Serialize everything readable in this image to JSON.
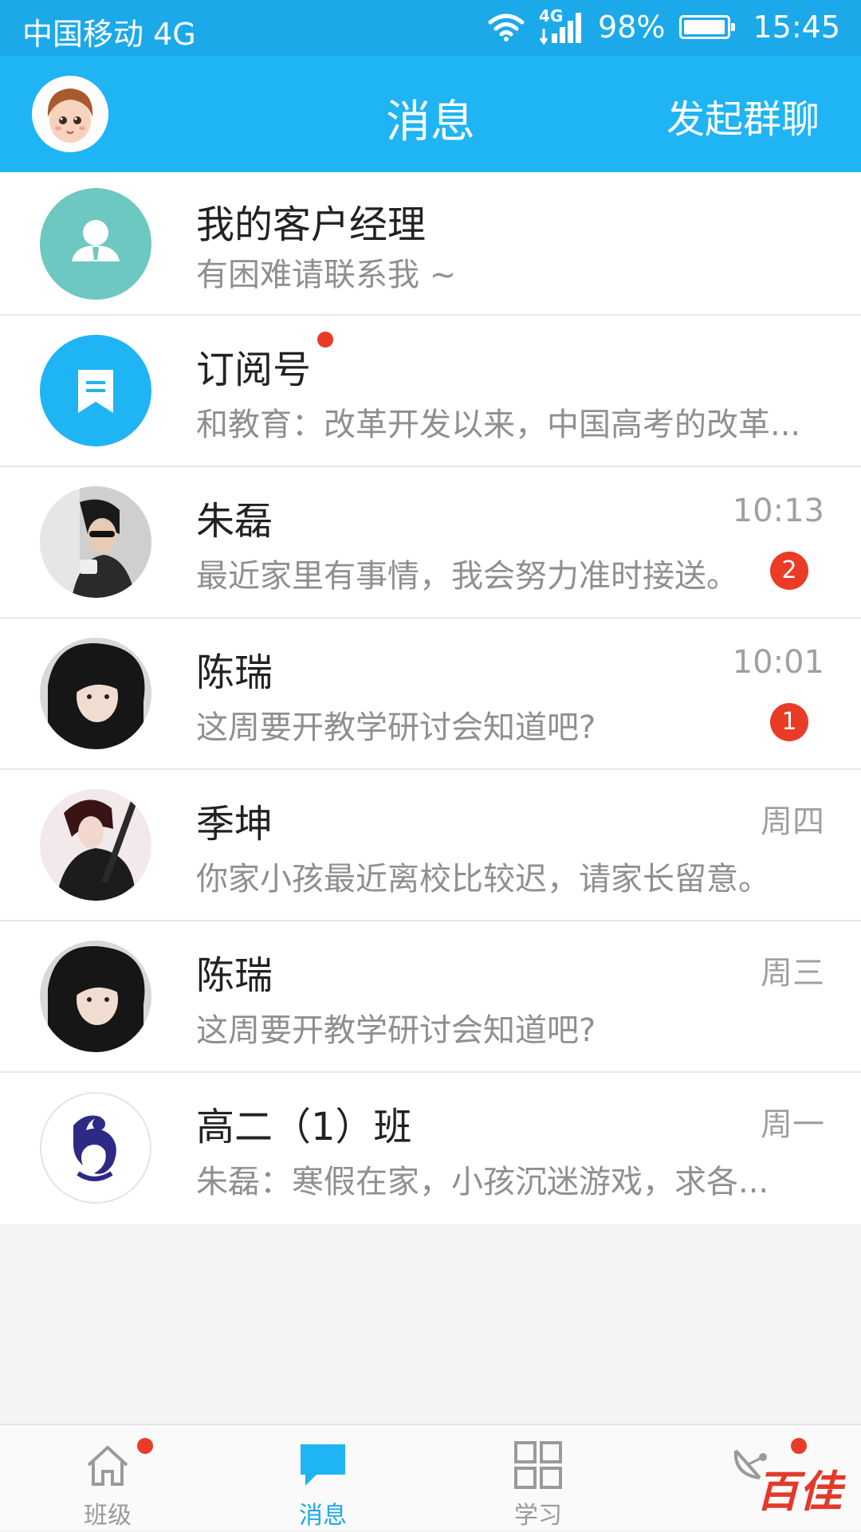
{
  "status_bar": {
    "carrier": "中国移动 4G",
    "network": "4G",
    "battery": "98%",
    "battery_level": 0.98,
    "time": "15:45",
    "icons": [
      "wifi-icon",
      "signal-icon",
      "battery-icon"
    ]
  },
  "header": {
    "title": "消息",
    "action_label": "发起群聊",
    "background": "#1fb4f4"
  },
  "conversations": [
    {
      "name": "我的客户经理",
      "preview": "有困难请联系我 ~",
      "time": "",
      "badge": "",
      "avatar": "manager-icon",
      "avatar_color": "#6cc8c1"
    },
    {
      "name": "订阅号",
      "preview": "和教育：改革开发以来，中国高考的改革...",
      "time": "",
      "badge": "",
      "unread_dot": true,
      "avatar": "bookmark-icon",
      "avatar_color": "#1fb4f4"
    },
    {
      "name": "朱磊",
      "preview": "最近家里有事情，我会努力准时接送。",
      "time": "10:13",
      "badge": "2",
      "avatar": "user-photo"
    },
    {
      "name": "陈瑞",
      "preview": "这周要开教学研讨会知道吧?",
      "time": "10:01",
      "badge": "1",
      "avatar": "user-photo"
    },
    {
      "name": "季坤",
      "preview": "你家小孩最近离校比较迟，请家长留意。",
      "time": "周四",
      "badge": "",
      "avatar": "user-photo"
    },
    {
      "name": "陈瑞",
      "preview": "这周要开教学研讨会知道吧?",
      "time": "周三",
      "badge": "",
      "avatar": "user-photo"
    },
    {
      "name": "高二（1）班",
      "preview": "朱磊：寒假在家，小孩沉迷游戏，求各...",
      "time": "周一",
      "badge": "",
      "avatar": "class-logo"
    }
  ],
  "tabs": [
    {
      "label": "班级",
      "icon": "home-icon",
      "unread_dot": true
    },
    {
      "label": "消息",
      "icon": "chat-icon",
      "active": true
    },
    {
      "label": "学习",
      "icon": "grid-icon"
    },
    {
      "label": "",
      "icon": "satellite-icon",
      "unread_dot": true
    }
  ],
  "watermark": "百佳",
  "colors": {
    "accent": "#1ca9ea",
    "badge": "#ea3b26",
    "muted_text": "#8f8f8f"
  }
}
